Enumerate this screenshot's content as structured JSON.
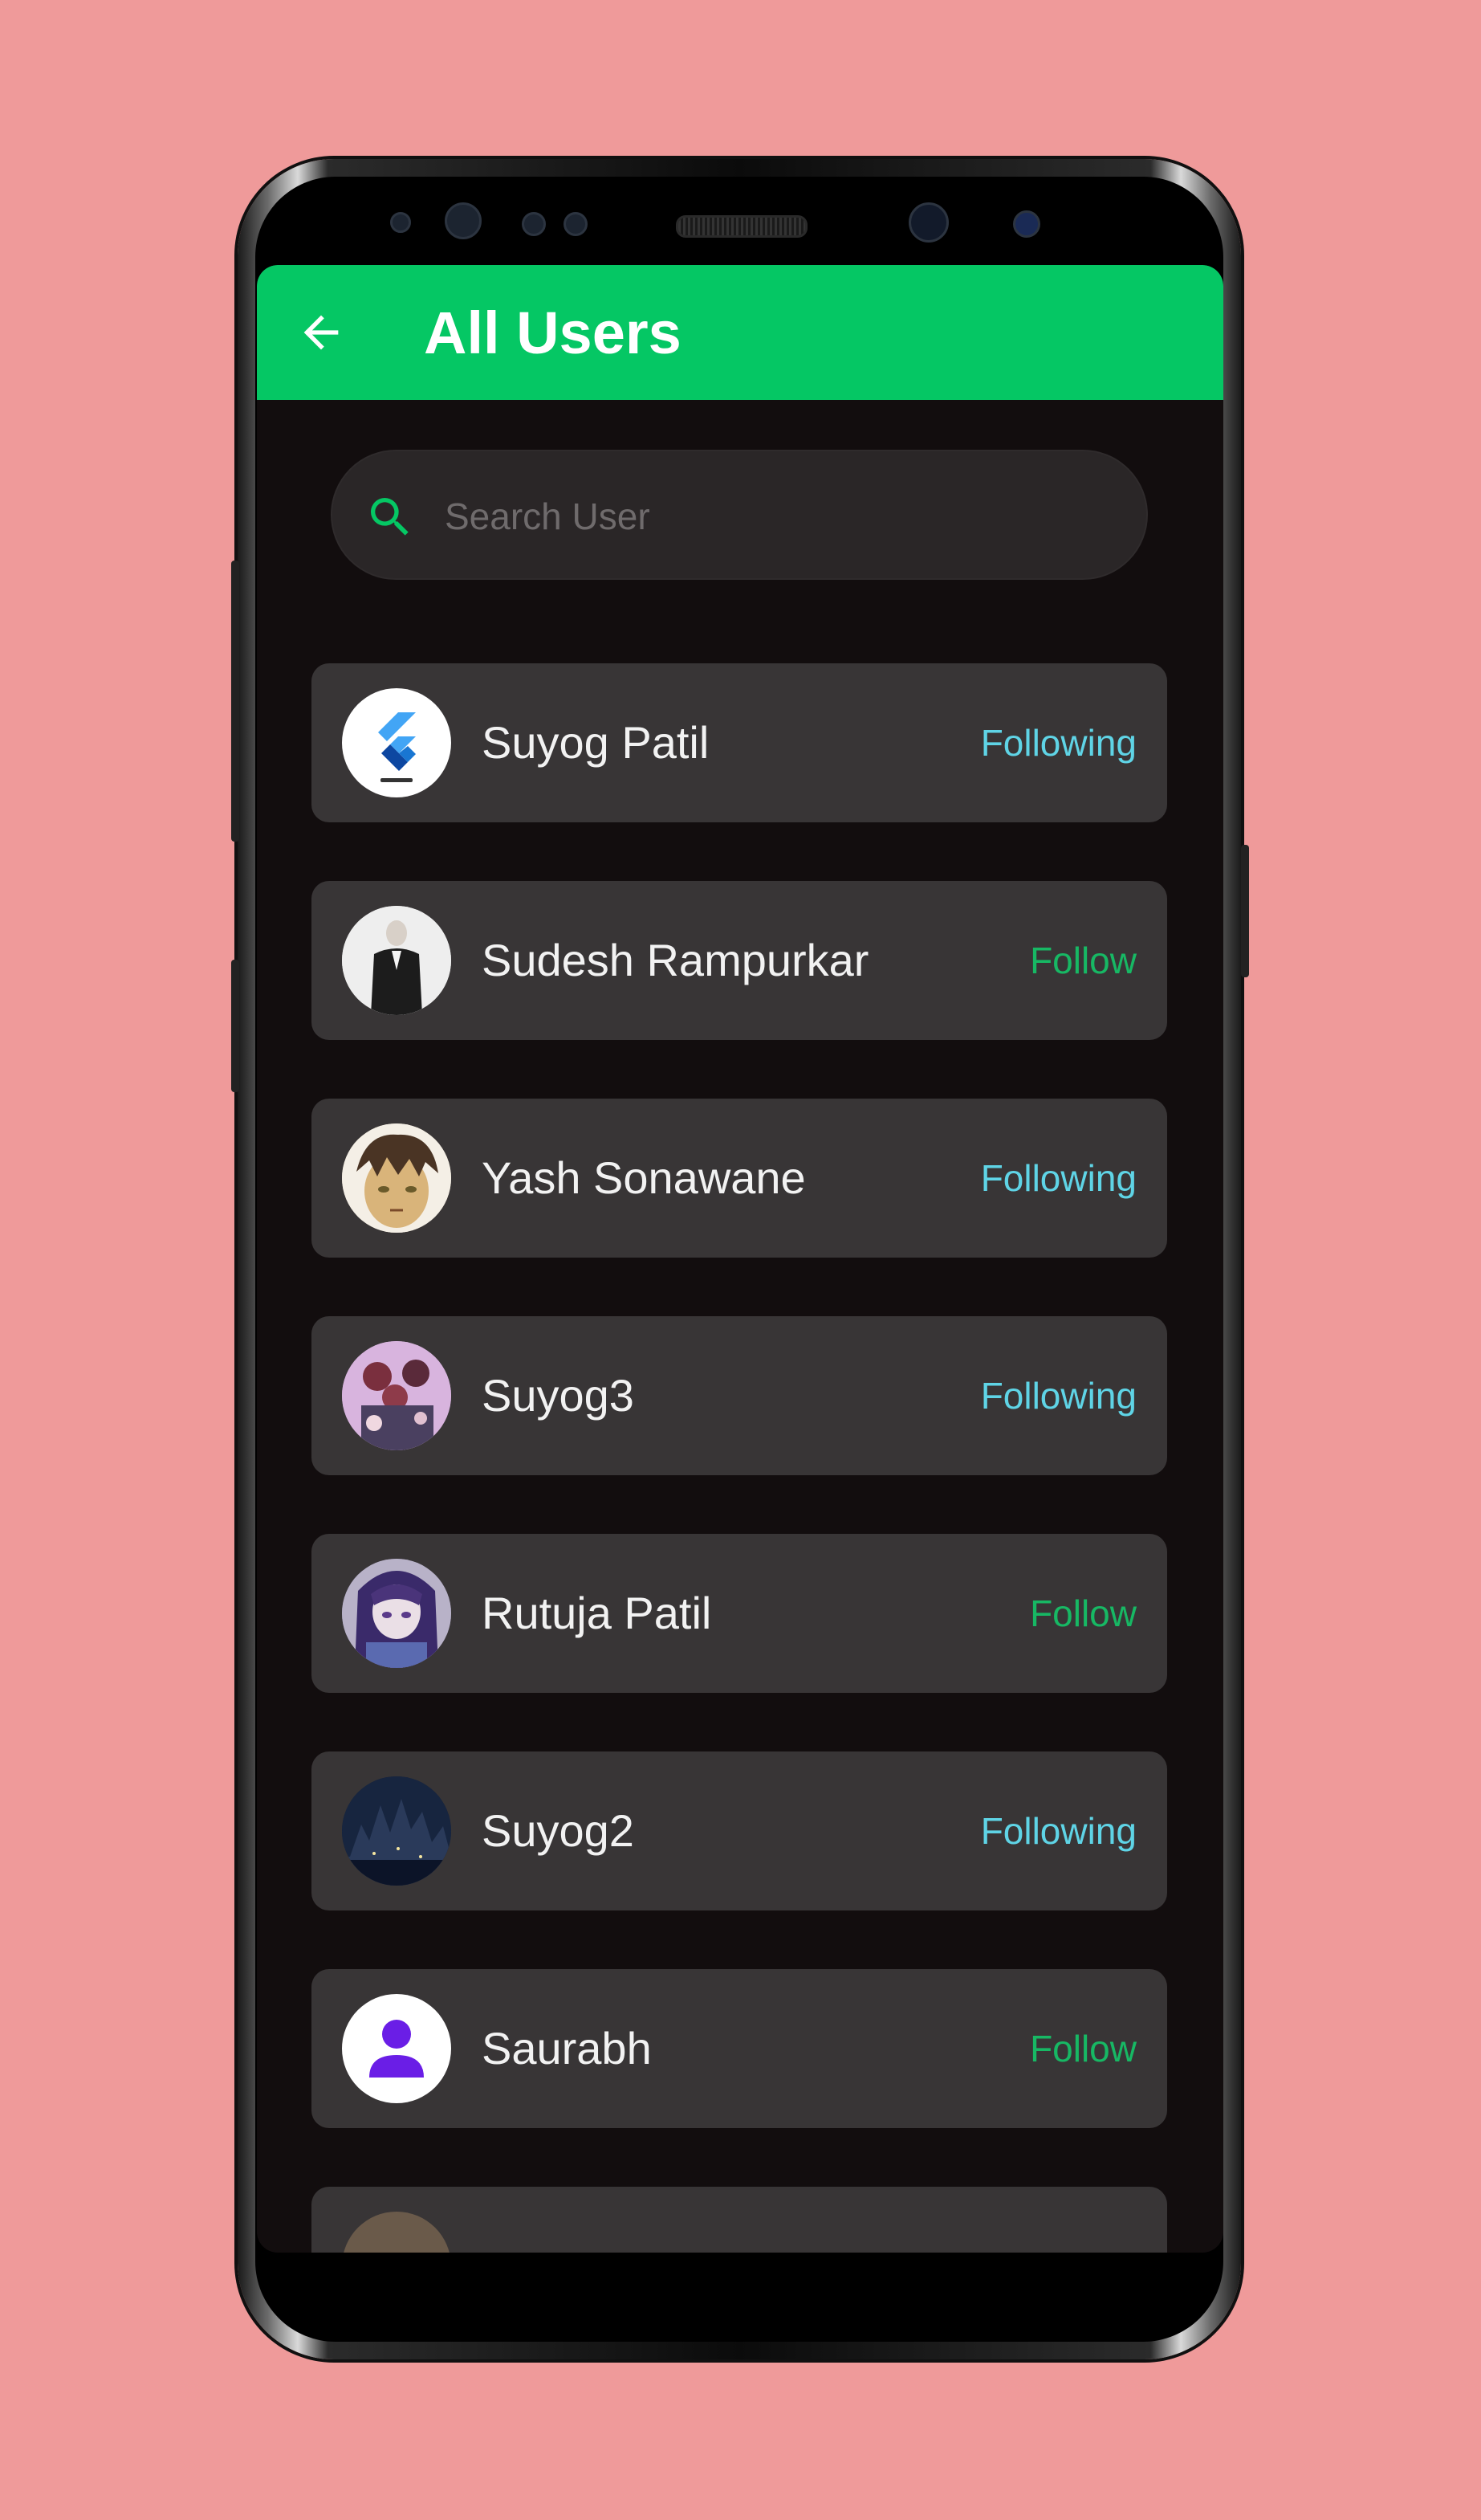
{
  "appbar": {
    "title": "All Users"
  },
  "search": {
    "placeholder": "Search User",
    "value": ""
  },
  "users": [
    {
      "name": "Suyog Patil",
      "status": "Following",
      "avatar": "flutter-logo"
    },
    {
      "name": "Sudesh Rampurkar",
      "status": "Follow",
      "avatar": "man-in-suit"
    },
    {
      "name": "Yash Sonawane",
      "status": "Following",
      "avatar": "anime-boy"
    },
    {
      "name": "Suyog3",
      "status": "Following",
      "avatar": "anime-group"
    },
    {
      "name": "Rutuja Patil",
      "status": "Follow",
      "avatar": "anime-girl"
    },
    {
      "name": "Suyog2",
      "status": "Following",
      "avatar": "night-castle"
    },
    {
      "name": "Saurabh",
      "status": "Follow",
      "avatar": "default-person"
    }
  ],
  "colors": {
    "appbar": "#05c764",
    "background": "#120d0e",
    "card": "#383536",
    "following": "#5fd4e6",
    "follow": "#17b864",
    "page": "#ef9a9a"
  }
}
